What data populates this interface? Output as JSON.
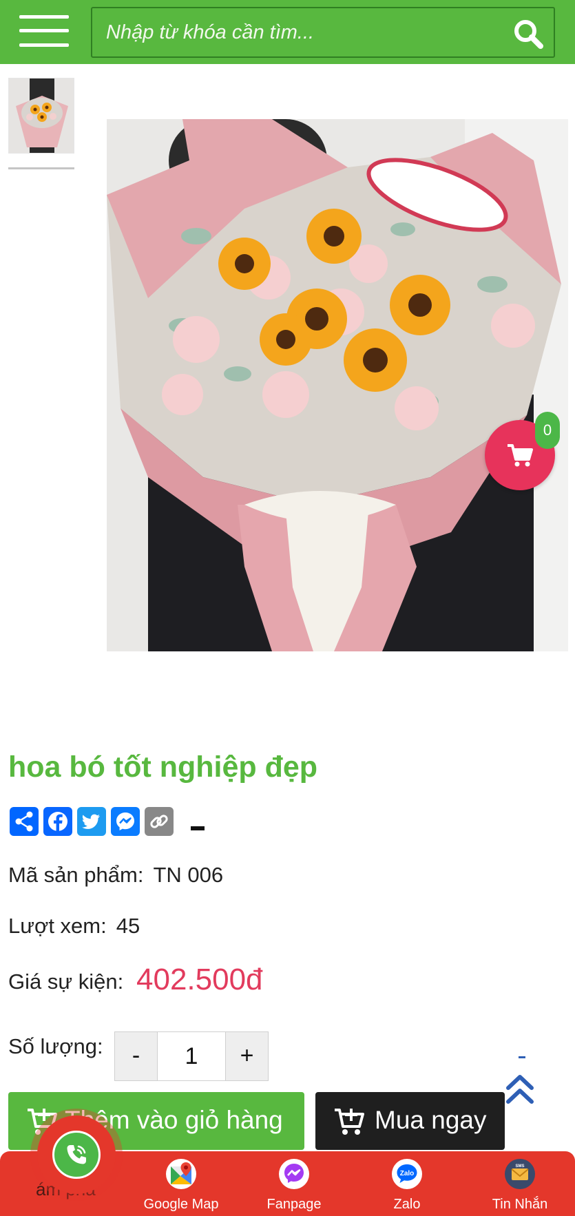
{
  "header": {
    "search_placeholder": "Nhập từ khóa cần tìm...",
    "brand_color": "#58b83f"
  },
  "cart": {
    "count": "0"
  },
  "product": {
    "title": "hoa bó tốt nghiệp đẹp",
    "code_label": "Mã sản phẩm:",
    "code_value": "TN 006",
    "views_label": "Lượt xem:",
    "views_value": "45",
    "price_label": "Giá sự kiện:",
    "price_value": "402.500đ",
    "price_color": "#e23b5d",
    "qty_label": "Số lượng:",
    "qty_minus": "-",
    "qty_value": "1",
    "qty_plus": "+"
  },
  "share": {
    "icons": [
      "share-icon",
      "facebook-icon",
      "twitter-icon",
      "messenger-icon",
      "copy-link-icon"
    ]
  },
  "actions": {
    "add_to_cart": "Thêm vào giỏ hàng",
    "buy_now": "Mua ngay"
  },
  "bottom_bar": {
    "partial_text": "ám phá",
    "items": [
      {
        "label": "Google Map",
        "icon": "google-map-icon"
      },
      {
        "label": "Fanpage",
        "icon": "messenger-icon"
      },
      {
        "label": "Zalo",
        "icon": "zalo-icon"
      },
      {
        "label": "Tin Nhắn",
        "icon": "sms-icon"
      }
    ],
    "zalo_badge": "Zalo",
    "sms_badge": "SMS"
  }
}
